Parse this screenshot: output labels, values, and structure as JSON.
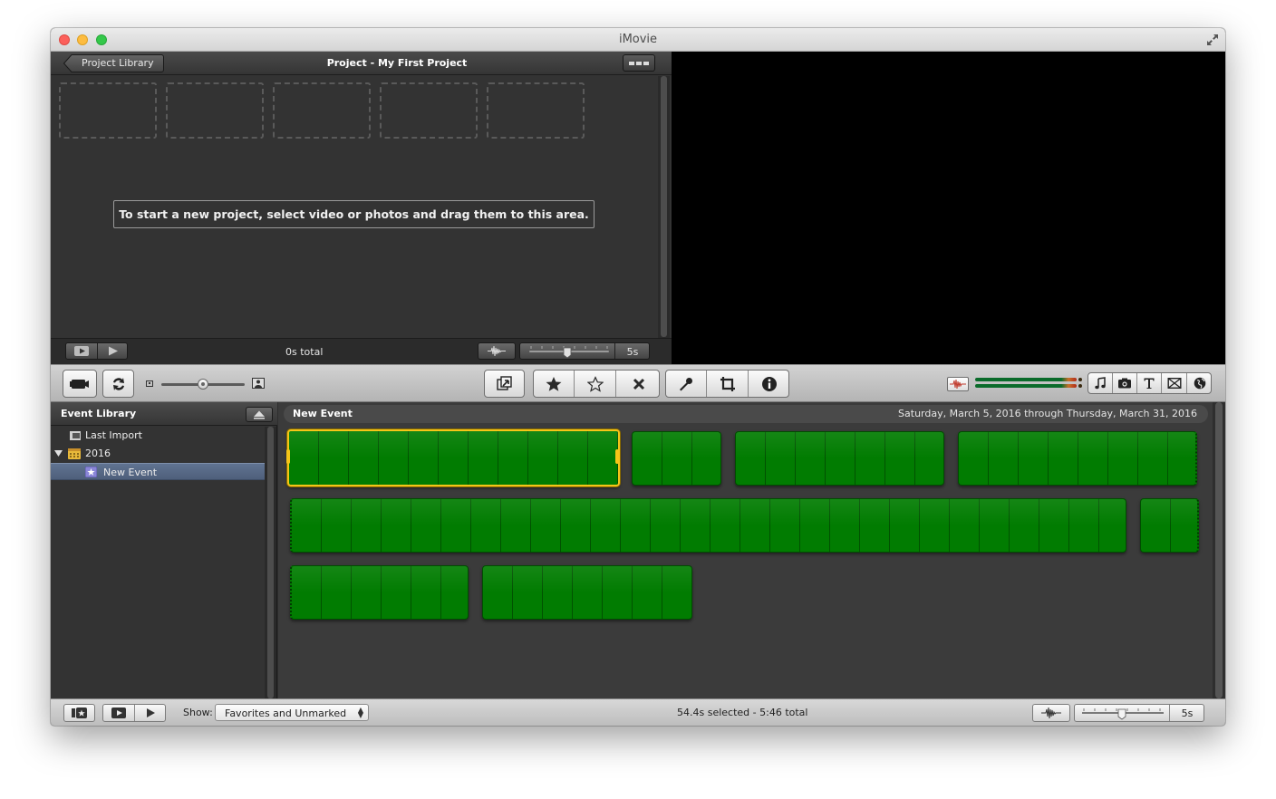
{
  "window": {
    "title": "iMovie"
  },
  "project": {
    "back_label": "Project Library",
    "title": "Project - My First Project",
    "drag_hint": "To start a new project, select video or photos and drag them to this area.",
    "total": "0s total",
    "zoom_value": "5s"
  },
  "event_library": {
    "title": "Event Library",
    "items": [
      {
        "label": "Last Import",
        "icon": "film-strip-icon"
      },
      {
        "label": "2016",
        "icon": "calendar-icon",
        "expanded": true
      },
      {
        "label": "New Event",
        "icon": "star-event-icon",
        "selected": true
      }
    ]
  },
  "event_browser": {
    "event_name": "New Event",
    "date_range": "Saturday, March 5, 2016 through Thursday, March 31, 2016",
    "clip_color": "#017c01",
    "selection_color": "#f5c518"
  },
  "bottom": {
    "show_label": "Show:",
    "show_value": "Favorites and Unmarked",
    "status": "54.4s selected - 5:46 total",
    "zoom_value": "5s"
  },
  "toolbar": {
    "left_buttons": [
      "camera-import-icon",
      "swap-icon"
    ],
    "edit_tools": [
      "add-to-project-icon"
    ],
    "rating_tools": [
      "favorite-star-icon",
      "unmark-star-icon",
      "reject-x-icon"
    ],
    "adjust_tools": [
      "voiceover-mic-icon",
      "crop-icon",
      "inspector-info-icon"
    ],
    "browser_tools": [
      "music-icon",
      "photo-icon",
      "title-icon",
      "transition-icon",
      "map-icon"
    ]
  }
}
